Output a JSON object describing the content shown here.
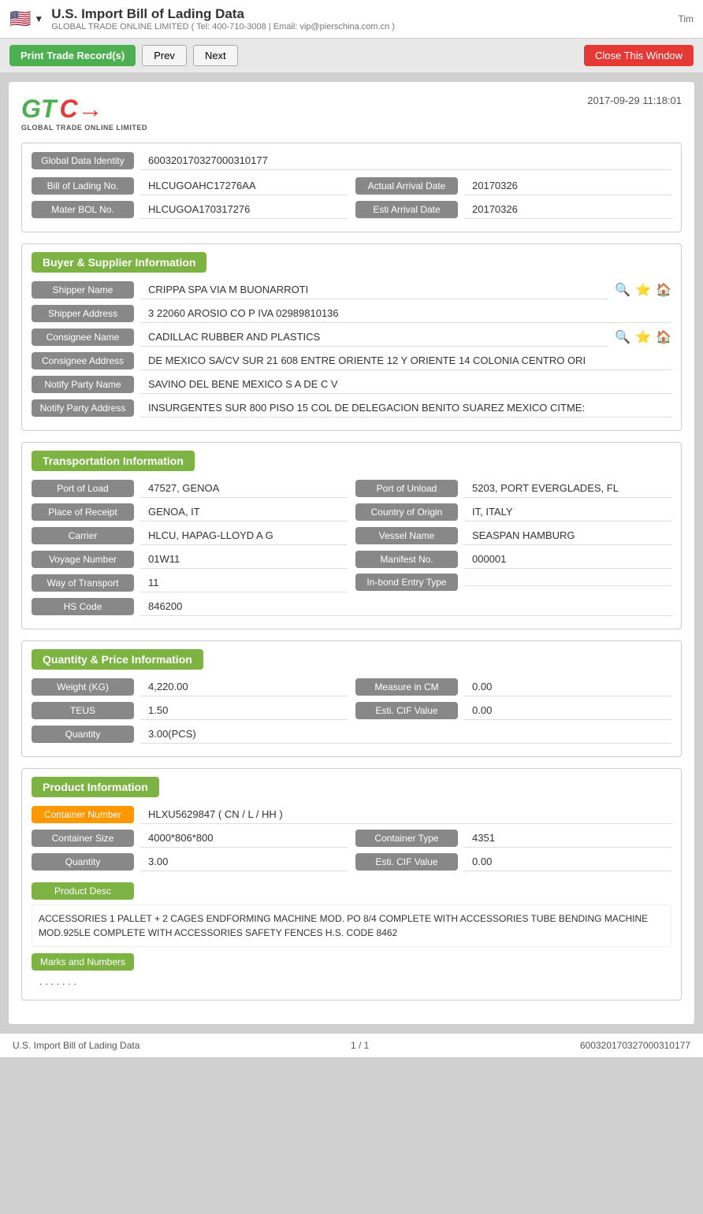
{
  "topbar": {
    "title": "U.S. Import Bill of Lading Data",
    "subtitle": "GLOBAL TRADE ONLINE LIMITED ( Tel: 400-710-3008 | Email: vip@pierschina.com.cn )",
    "right_text": "Tim"
  },
  "toolbar": {
    "print_label": "Print Trade Record(s)",
    "prev_label": "Prev",
    "next_label": "Next",
    "close_label": "Close This Window"
  },
  "doc": {
    "date": "2017-09-29 11:18:01",
    "logo_company": "GLOBAL TRADE ONLINE LIMITED",
    "global_data_identity": {
      "label": "Global Data Identity",
      "value": "600320170327000310177"
    },
    "bill_of_lading_no": {
      "label": "Bill of Lading No.",
      "value": "HLCUGOAHC17276AA"
    },
    "actual_arrival_date": {
      "label": "Actual Arrival Date",
      "value": "20170326"
    },
    "mater_bol_no": {
      "label": "Mater BOL No.",
      "value": "HLCUGOA170317276"
    },
    "esti_arrival_date": {
      "label": "Esti Arrival Date",
      "value": "20170326"
    }
  },
  "buyer_supplier": {
    "section_title": "Buyer & Supplier Information",
    "shipper_name": {
      "label": "Shipper Name",
      "value": "CRIPPA SPA VIA M BUONARROTI"
    },
    "shipper_address": {
      "label": "Shipper Address",
      "value": "3 22060 AROSIO CO P IVA 02989810136"
    },
    "consignee_name": {
      "label": "Consignee Name",
      "value": "CADILLAC RUBBER AND PLASTICS"
    },
    "consignee_address": {
      "label": "Consignee Address",
      "value": "DE MEXICO SA/CV SUR 21 608 ENTRE ORIENTE 12 Y ORIENTE 14 COLONIA CENTRO ORI"
    },
    "notify_party_name": {
      "label": "Notify Party Name",
      "value": "SAVINO DEL BENE MEXICO S A DE C V"
    },
    "notify_party_address": {
      "label": "Notify Party Address",
      "value": "INSURGENTES SUR 800 PISO 15 COL DE DELEGACION BENITO SUAREZ MEXICO CITME:"
    }
  },
  "transportation": {
    "section_title": "Transportation Information",
    "port_of_load": {
      "label": "Port of Load",
      "value": "47527, GENOA"
    },
    "port_of_unload": {
      "label": "Port of Unload",
      "value": "5203, PORT EVERGLADES, FL"
    },
    "place_of_receipt": {
      "label": "Place of Receipt",
      "value": "GENOA, IT"
    },
    "country_of_origin": {
      "label": "Country of Origin",
      "value": "IT, ITALY"
    },
    "carrier": {
      "label": "Carrier",
      "value": "HLCU, HAPAG-LLOYD A G"
    },
    "vessel_name": {
      "label": "Vessel Name",
      "value": "SEASPAN HAMBURG"
    },
    "voyage_number": {
      "label": "Voyage Number",
      "value": "01W11"
    },
    "manifest_no": {
      "label": "Manifest No.",
      "value": "000001"
    },
    "way_of_transport": {
      "label": "Way of Transport",
      "value": "11"
    },
    "inbond_entry_type": {
      "label": "In-bond Entry Type",
      "value": ""
    },
    "hs_code": {
      "label": "HS Code",
      "value": "846200"
    }
  },
  "quantity_price": {
    "section_title": "Quantity & Price Information",
    "weight_kg": {
      "label": "Weight (KG)",
      "value": "4,220.00"
    },
    "measure_in_cm": {
      "label": "Measure in CM",
      "value": "0.00"
    },
    "teus": {
      "label": "TEUS",
      "value": "1.50"
    },
    "esti_cif_value": {
      "label": "Esti. CIF Value",
      "value": "0.00"
    },
    "quantity": {
      "label": "Quantity",
      "value": "3.00(PCS)"
    }
  },
  "product_info": {
    "section_title": "Product Information",
    "container_number": {
      "label": "Container Number",
      "value": "HLXU5629847 ( CN / L / HH )"
    },
    "container_size": {
      "label": "Container Size",
      "value": "4000*806*800"
    },
    "container_type": {
      "label": "Container Type",
      "value": "4351"
    },
    "quantity": {
      "label": "Quantity",
      "value": "3.00"
    },
    "esti_cif_value": {
      "label": "Esti. CIF Value",
      "value": "0.00"
    },
    "product_desc_label": "Product Desc",
    "product_desc_text": "ACCESSORIES 1 PALLET + 2 CAGES ENDFORMING MACHINE MOD. PO 8/4 COMPLETE WITH ACCESSORIES TUBE BENDING MACHINE MOD.925LE COMPLETE WITH ACCESSORIES SAFETY FENCES H.S. CODE 8462",
    "marks_and_numbers_label": "Marks and Numbers",
    "marks_and_numbers_value": ". . . . . . ."
  },
  "footer": {
    "left": "U.S. Import Bill of Lading Data",
    "middle": "1 / 1",
    "right": "600320170327000310177"
  }
}
